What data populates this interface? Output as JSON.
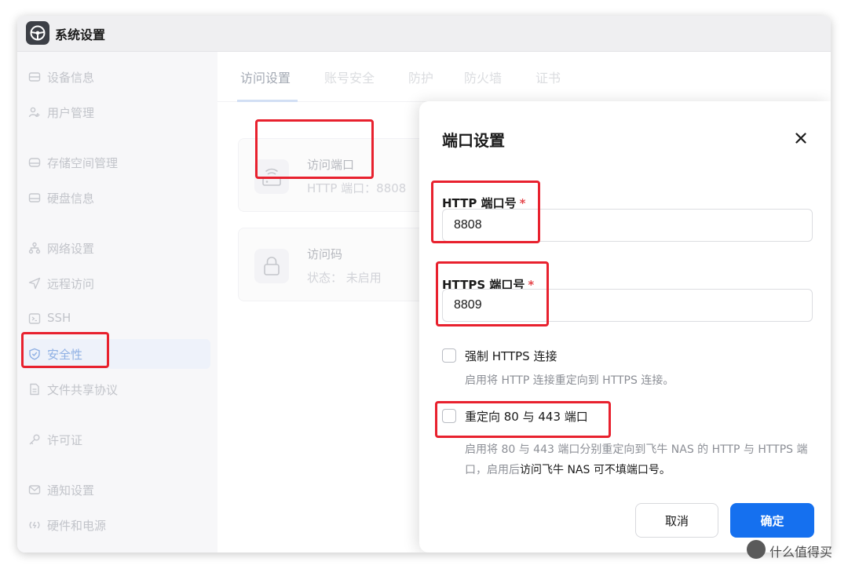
{
  "window": {
    "title": "系统设置",
    "app_icon": "steering-wheel-icon"
  },
  "sidebar": {
    "items": [
      {
        "label": "设备信息",
        "icon": "device-icon"
      },
      {
        "label": "用户管理",
        "icon": "users-icon"
      },
      {
        "label": "存储空间管理",
        "icon": "storage-icon"
      },
      {
        "label": "硬盘信息",
        "icon": "disk-icon"
      },
      {
        "label": "网络设置",
        "icon": "network-icon"
      },
      {
        "label": "远程访问",
        "icon": "send-icon"
      },
      {
        "label": "SSH",
        "icon": "terminal-icon"
      },
      {
        "label": "安全性",
        "icon": "shield-icon",
        "active": true
      },
      {
        "label": "文件共享协议",
        "icon": "file-icon"
      },
      {
        "label": "许可证",
        "icon": "key-icon"
      },
      {
        "label": "通知设置",
        "icon": "mail-icon"
      },
      {
        "label": "硬件和电源",
        "icon": "power-icon"
      }
    ]
  },
  "tabs": [
    {
      "label": "访问设置",
      "active": true
    },
    {
      "label": "账号安全"
    },
    {
      "label": "防护"
    },
    {
      "label": "防火墙"
    },
    {
      "label": "证书"
    }
  ],
  "cards": {
    "port": {
      "title": "访问端口",
      "subtitle": "HTTP 端口：8808",
      "icon": "router-icon"
    },
    "code": {
      "title": "访问码",
      "subtitle": "状态：  未启用",
      "icon": "lock-icon"
    }
  },
  "dialog": {
    "title": "端口设置",
    "http_label": "HTTP 端口号",
    "http_value": "8808",
    "https_label": "HTTPS 端口号",
    "https_value": "8809",
    "required_mark": "*",
    "force_https_label": "强制 HTTPS 连接",
    "force_https_desc": "启用将 HTTP 连接重定向到 HTTPS 连接。",
    "redirect_label": "重定向 80 与 443 端口",
    "redirect_desc_1": "启用将 80 与 443 端口分别重定向到飞牛 NAS 的 HTTP 与 HTTPS 端口，启用后",
    "redirect_desc_2": "访问飞牛 NAS 可不填端口号。",
    "cancel_label": "取消",
    "ok_label": "确定"
  },
  "watermark": {
    "text": "什么值得买"
  },
  "colors": {
    "accent": "#1570ef",
    "highlight": "#e8212e",
    "required": "#e5484d"
  }
}
